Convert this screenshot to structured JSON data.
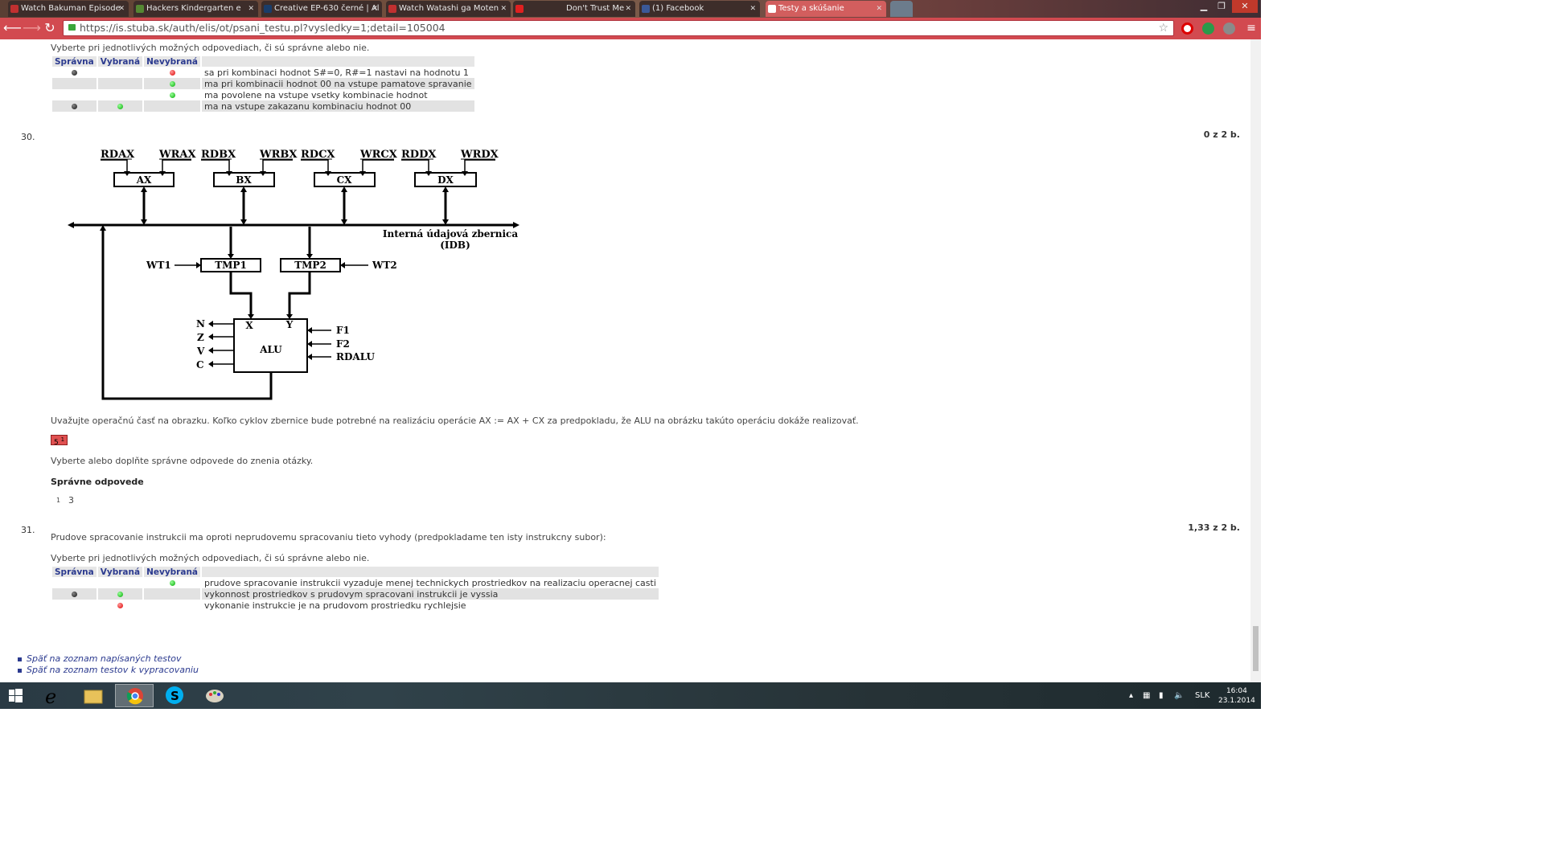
{
  "browser": {
    "tabs": [
      {
        "label": "Watch Bakuman Episode",
        "favicon_color": "#c03030"
      },
      {
        "label": "Hackers Kindergarten e",
        "favicon_color": "#558833"
      },
      {
        "label": "Creative EP-630 černé | Al",
        "favicon_color": "#1a3d6a"
      },
      {
        "label": "Watch Watashi ga Moten",
        "favicon_color": "#c03030"
      },
      {
        "label": "Don't Trust Me",
        "favicon_color": "#e02020"
      },
      {
        "label": "(1) Facebook",
        "favicon_color": "#3b5998"
      },
      {
        "label": "Testy a skúšanie",
        "favicon_color": "#c83030",
        "active": true
      }
    ],
    "url": "https://is.stuba.sk/auth/elis/ot/psani_testu.pl?vysledky=1;detail=105004",
    "accent": "#d24a50"
  },
  "q29": {
    "instruction": "Vyberte pri jednotlivých možných odpovediach, či sú správne alebo nie.",
    "headers": [
      "Správna",
      "Vybraná",
      "Nevybraná",
      ""
    ],
    "rows": [
      {
        "spravna": "black",
        "vybrana": "",
        "nevybrana": "red",
        "text": "sa pri kombinaci hodnot S#=0, R#=1 nastavi na hodnotu 1"
      },
      {
        "spravna": "",
        "vybrana": "",
        "nevybrana": "green",
        "text": "ma pri kombinacii hodnot 00 na vstupe pamatove spravanie"
      },
      {
        "spravna": "",
        "vybrana": "",
        "nevybrana": "green",
        "text": "ma povolene na vstupe vsetky kombinacie hodnot"
      },
      {
        "spravna": "black",
        "vybrana": "green",
        "nevybrana": "",
        "text": "ma na vstupe zakazanu kombinaciu hodnot 00"
      }
    ]
  },
  "q30": {
    "number": "30.",
    "score": "0 z 2 b.",
    "diagram": {
      "top_signals": [
        "RDAX",
        "WRAX",
        "RDBX",
        "WRBX",
        "RDCX",
        "WRCX",
        "RDDX",
        "WRDX"
      ],
      "registers": [
        "AX",
        "BX",
        "CX",
        "DX"
      ],
      "bus_label_1": "Interná údajová zbernica",
      "bus_label_2": "(IDB)",
      "wt1": "WT1",
      "wt2": "WT2",
      "tmp1": "TMP1",
      "tmp2": "TMP2",
      "alu": "ALU",
      "alu_x": "X",
      "alu_y": "Y",
      "flags": [
        "N",
        "Z",
        "V",
        "C"
      ],
      "controls": [
        "F1",
        "F2",
        "RDALU"
      ]
    },
    "question": "Uvažujte operačnú časť na obrazku. Koľko cyklov zbernice bude potrebné na realizáciu operácie AX := AX + CX za predpokladu, že ALU na obrázku takúto operáciu dokáže realizovať.",
    "answer": "5",
    "answer_sup": "1",
    "instruction": "Vyberte alebo doplňte správne odpovede do znenia otázky.",
    "correct_heading": "Správne odpovede",
    "correct_index": "1",
    "correct_value": "3"
  },
  "q31": {
    "number": "31.",
    "score": "1,33 z 2 b.",
    "question": "Prudove spracovanie instrukcii ma oproti neprudovemu spracovaniu tieto vyhody (predpokladame ten isty instrukcny subor):",
    "instruction": "Vyberte pri jednotlivých možných odpovediach, či sú správne alebo nie.",
    "headers": [
      "Správna",
      "Vybraná",
      "Nevybraná",
      ""
    ],
    "rows": [
      {
        "spravna": "",
        "vybrana": "",
        "nevybrana": "green",
        "text": "prudove spracovanie instrukcii vyzaduje menej technickych prostriedkov na realizaciu operacnej casti"
      },
      {
        "spravna": "black",
        "vybrana": "green",
        "nevybrana": "",
        "text": "vykonnost prostriedkov s prudovym spracovani instrukcii je vyssia"
      },
      {
        "spravna": "",
        "vybrana": "red",
        "nevybrana": "",
        "text": "vykonanie instrukcie je na prudovom prostriedku rychlejsie"
      }
    ]
  },
  "links": [
    "Späť na zoznam napísaných testov",
    "Späť na zoznam testov k vypracovaniu"
  ],
  "taskbar": {
    "language": "SLK",
    "time": "16:04",
    "date": "23.1.2014"
  }
}
